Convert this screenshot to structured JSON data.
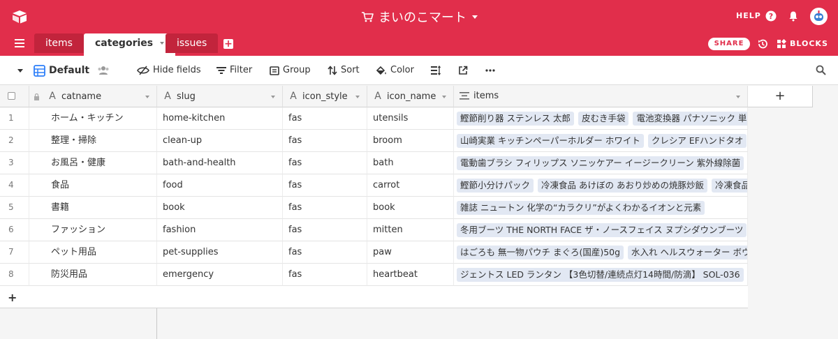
{
  "base": {
    "title": "まいのこマート"
  },
  "header": {
    "help_label": "HELP",
    "share_label": "SHARE",
    "blocks_label": "BLOCKS"
  },
  "tabs": [
    {
      "label": "items",
      "active": false
    },
    {
      "label": "categories",
      "active": true
    },
    {
      "label": "issues",
      "active": false
    }
  ],
  "toolbar": {
    "view_name": "Default",
    "hide_fields": "Hide fields",
    "filter": "Filter",
    "group": "Group",
    "sort": "Sort",
    "color": "Color"
  },
  "columns": [
    {
      "name": "catname",
      "icon": "text-icon"
    },
    {
      "name": "slug",
      "icon": "text-icon"
    },
    {
      "name": "icon_style",
      "icon": "text-icon"
    },
    {
      "name": "icon_name",
      "icon": "text-icon"
    },
    {
      "name": "items",
      "icon": "linked-records-icon"
    }
  ],
  "rows": [
    {
      "num": "1",
      "catname": "ホーム・キッチン",
      "slug": "home-kitchen",
      "icon_style": "fas",
      "icon_name": "utensils",
      "items": [
        "鰹節削り器 ステンレス 太郎",
        "皮むき手袋",
        "電池変換器 パナソニック 単"
      ]
    },
    {
      "num": "2",
      "catname": "整理・掃除",
      "slug": "clean-up",
      "icon_style": "fas",
      "icon_name": "broom",
      "items": [
        "山崎実業 キッチンペーパーホルダー ホワイト",
        "クレシア EFハンドタオ"
      ]
    },
    {
      "num": "3",
      "catname": "お風呂・健康",
      "slug": "bath-and-health",
      "icon_style": "fas",
      "icon_name": "bath",
      "items": [
        "電動歯ブラシ フィリップス ソニッケアー イージークリーン 紫外線除菌"
      ]
    },
    {
      "num": "4",
      "catname": "食品",
      "slug": "food",
      "icon_style": "fas",
      "icon_name": "carrot",
      "items": [
        "鰹節小分けパック",
        "冷凍食品 あけぼの あおり炒めの焼豚炒飯",
        "冷凍食品"
      ]
    },
    {
      "num": "5",
      "catname": "書籍",
      "slug": "book",
      "icon_style": "fas",
      "icon_name": "book",
      "items": [
        "雑誌 ニュートン 化学の“カラクリ”がよくわかるイオンと元素"
      ]
    },
    {
      "num": "6",
      "catname": "ファッション",
      "slug": "fashion",
      "icon_style": "fas",
      "icon_name": "mitten",
      "items": [
        "冬用ブーツ THE NORTH FACE ザ・ノースフェイス ヌプシダウンブーツ"
      ]
    },
    {
      "num": "7",
      "catname": "ペット用品",
      "slug": "pet-supplies",
      "icon_style": "fas",
      "icon_name": "paw",
      "items": [
        "はごろも 無一物パウチ まぐろ(国産)50g",
        "水入れ ヘルスウォーター ボウル"
      ]
    },
    {
      "num": "8",
      "catname": "防災用品",
      "slug": "emergency",
      "icon_style": "fas",
      "icon_name": "heartbeat",
      "items": [
        "ジェントス LED ランタン 【3色切替/連続点灯14時間/防滴】 SOL-036"
      ]
    }
  ],
  "colors": {
    "brand": "#e12e4b",
    "tab_inactive": "#c2243c",
    "chip": "#e2e8f3",
    "view_icon": "#2d7ff9"
  }
}
